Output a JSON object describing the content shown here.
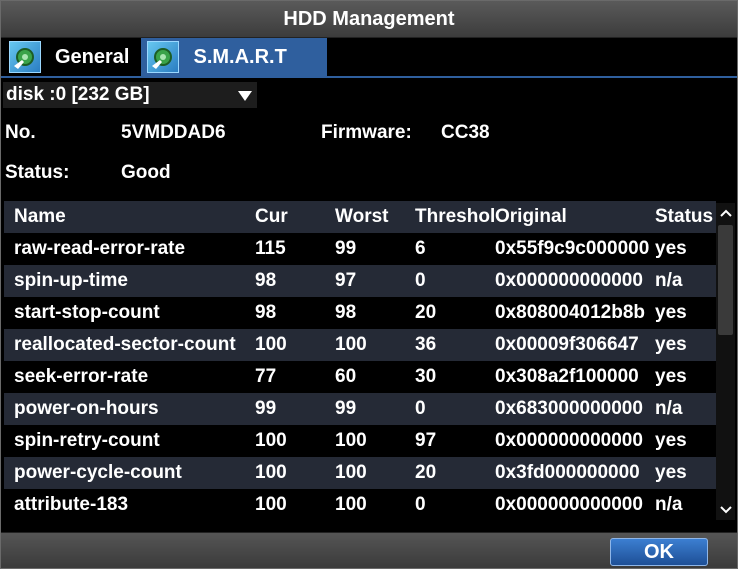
{
  "window": {
    "title": "HDD Management"
  },
  "tabs": [
    {
      "label": "General",
      "icon": "hdd-settings-icon"
    },
    {
      "label": "S.M.A.R.T",
      "icon": "hdd-settings-icon",
      "active": true
    }
  ],
  "disk_select": {
    "value": "disk :0 [232 GB]"
  },
  "info": {
    "no_label": "No.",
    "no_value": "5VMDDAD6",
    "firmware_label": "Firmware:",
    "firmware_value": "CC38",
    "status_label": "Status:",
    "status_value": "Good"
  },
  "table": {
    "headers": [
      "Name",
      "Cur",
      "Worst",
      "Threshold",
      "Original",
      "Status"
    ],
    "rows": [
      [
        "raw-read-error-rate",
        "115",
        "99",
        "6",
        "0x55f9c9c000000",
        "yes"
      ],
      [
        "spin-up-time",
        "98",
        "97",
        "0",
        "0x000000000000",
        "n/a"
      ],
      [
        "start-stop-count",
        "98",
        "98",
        "20",
        "0x808004012b8b",
        "yes"
      ],
      [
        "reallocated-sector-count",
        "100",
        "100",
        "36",
        "0x00009f306647",
        "yes"
      ],
      [
        "seek-error-rate",
        "77",
        "60",
        "30",
        "0x308a2f100000",
        "yes"
      ],
      [
        "power-on-hours",
        "99",
        "99",
        "0",
        "0x683000000000",
        "n/a"
      ],
      [
        "spin-retry-count",
        "100",
        "100",
        "97",
        "0x000000000000",
        "yes"
      ],
      [
        "power-cycle-count",
        "100",
        "100",
        "20",
        "0x3fd000000000",
        "yes"
      ],
      [
        "attribute-183",
        "100",
        "100",
        "0",
        "0x000000000000",
        "n/a"
      ]
    ]
  },
  "footer": {
    "ok_label": "OK"
  }
}
